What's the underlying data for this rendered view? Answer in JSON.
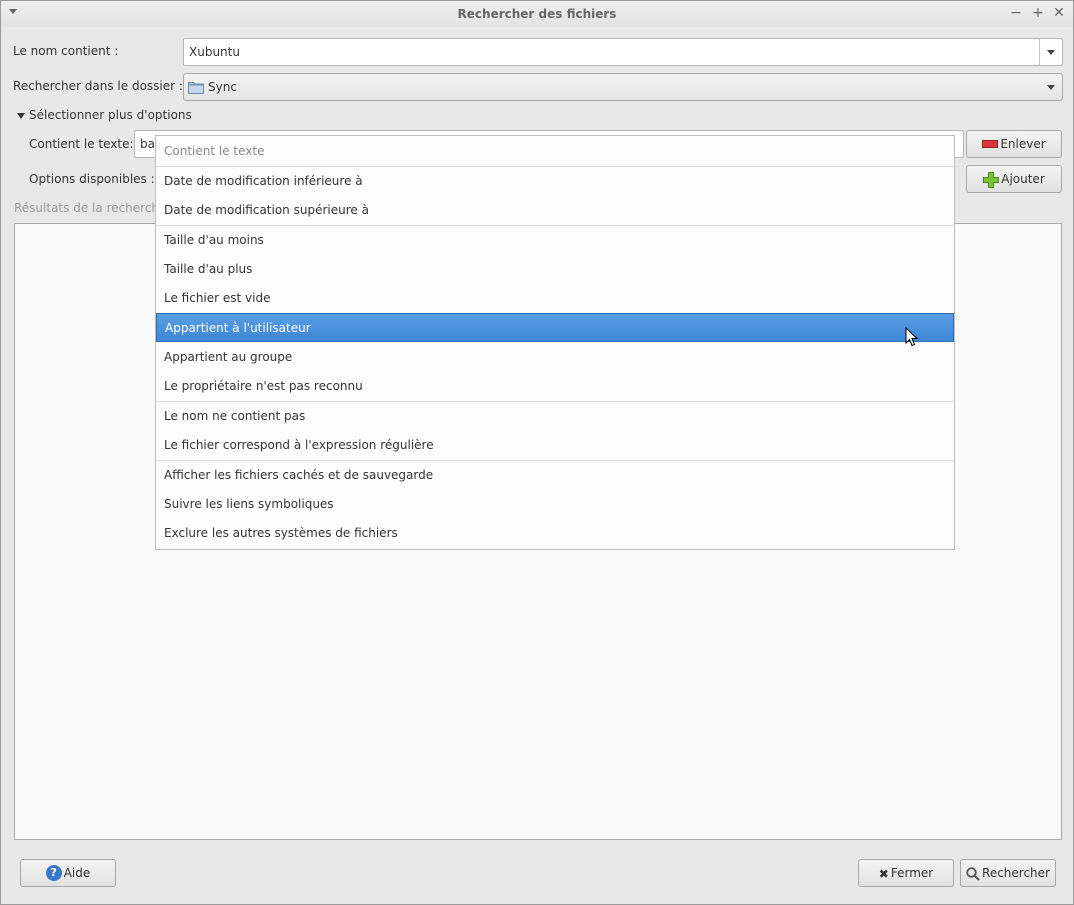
{
  "window": {
    "title": "Rechercher des fichiers"
  },
  "form": {
    "name_label": "Le nom contient :",
    "name_value": "Xubuntu",
    "folder_label": "Rechercher dans le dossier :",
    "folder_value": "Sync",
    "more_options_label": "Sélectionner plus d'options",
    "contains_text_label": "Contient le texte:",
    "contains_text_value": "bas",
    "available_options_label": "Options disponibles :",
    "results_label": "Résultats de la recherche"
  },
  "buttons": {
    "remove": "Enlever",
    "add": "Ajouter",
    "help": "Aide",
    "close": "Fermer",
    "search": "Rechercher"
  },
  "menu": {
    "items": [
      "Contient le texte",
      "Date de modification inférieure à",
      "Date de modification supérieure à",
      "Taille d'au moins",
      "Taille d'au plus",
      "Le fichier est vide",
      "Appartient à l'utilisateur",
      "Appartient au groupe",
      "Le propriétaire n'est pas reconnu",
      "Le nom ne contient pas",
      "Le fichier correspond à l'expression régulière",
      "Afficher les fichiers cachés et de sauvegarde",
      "Suivre les liens symboliques",
      "Exclure les autres systèmes de fichiers"
    ],
    "selected_index": 6
  },
  "colors": {
    "selection": "#4a90d9",
    "remove_icon": "#d9373a",
    "add_icon": "#6cb52d",
    "help_icon": "#3a78c9"
  }
}
